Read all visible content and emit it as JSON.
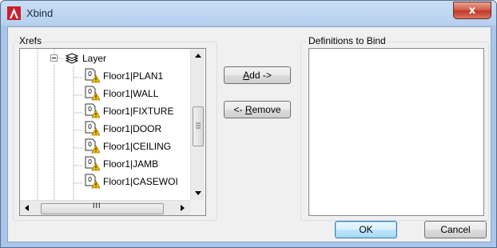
{
  "window": {
    "title": "Xbind",
    "close_glyph": "x"
  },
  "xrefs": {
    "label": "Xrefs",
    "root_label": "Layer",
    "items": [
      {
        "label": "Floor1|PLAN1"
      },
      {
        "label": "Floor1|WALL"
      },
      {
        "label": "Floor1|FIXTURE"
      },
      {
        "label": "Floor1|DOOR"
      },
      {
        "label": "Floor1|CEILING"
      },
      {
        "label": "Floor1|JAMB"
      },
      {
        "label": "Floor1|CASEWOI"
      }
    ],
    "hscroll_grip": "III"
  },
  "buttons": {
    "add_pre": "",
    "add_mnemonic": "A",
    "add_post": "dd ->",
    "remove_pre": "<- ",
    "remove_mnemonic": "R",
    "remove_post": "emove",
    "ok": "OK",
    "cancel": "Cancel"
  },
  "definitions": {
    "label": "Definitions to Bind"
  },
  "colors": {
    "accent": "#3c7fb1",
    "close": "#c0392b",
    "warning": "#f5c400"
  }
}
